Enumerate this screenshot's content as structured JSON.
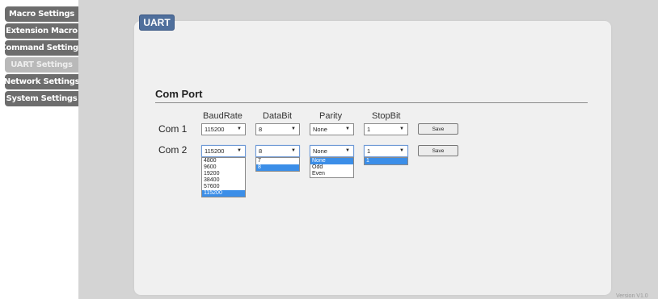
{
  "sidebar": {
    "items": [
      {
        "label": "Macro Settings"
      },
      {
        "label": "Extension Macro"
      },
      {
        "label": "Command Settings"
      },
      {
        "label": "UART Settings"
      },
      {
        "label": "Network Settings"
      },
      {
        "label": "System Settings"
      }
    ],
    "active_item": "UART Settings"
  },
  "panel": {
    "tab_label": "UART",
    "section_title": "Com Port"
  },
  "columns": {
    "baud": "BaudRate",
    "data": "DataBit",
    "parity": "Parity",
    "stop": "StopBit"
  },
  "rows": [
    {
      "label": "Com 1",
      "baud": "115200",
      "data": "8",
      "parity": "None",
      "stop": "1",
      "save_label": "Save"
    },
    {
      "label": "Com 2",
      "baud": "115200",
      "data": "8",
      "parity": "None",
      "stop": "1",
      "save_label": "Save"
    }
  ],
  "dropdowns": {
    "baud": {
      "options": [
        "4800",
        "9600",
        "19200",
        "38400",
        "57600",
        "115200"
      ],
      "selected": "115200"
    },
    "data": {
      "options": [
        "7",
        "8"
      ],
      "selected": "8"
    },
    "parity": {
      "options": [
        "None",
        "Odd",
        "Even"
      ],
      "selected": "None"
    },
    "stop": {
      "options": [
        "1"
      ],
      "selected": "1"
    }
  },
  "footer": {
    "version": "Version V1.0"
  },
  "colors": {
    "sidebar_button": "#6d6d6d",
    "sidebar_active": "#b9b9b9",
    "tab_blue": "#4f6f9c",
    "selection_blue": "#3b8ee8"
  }
}
